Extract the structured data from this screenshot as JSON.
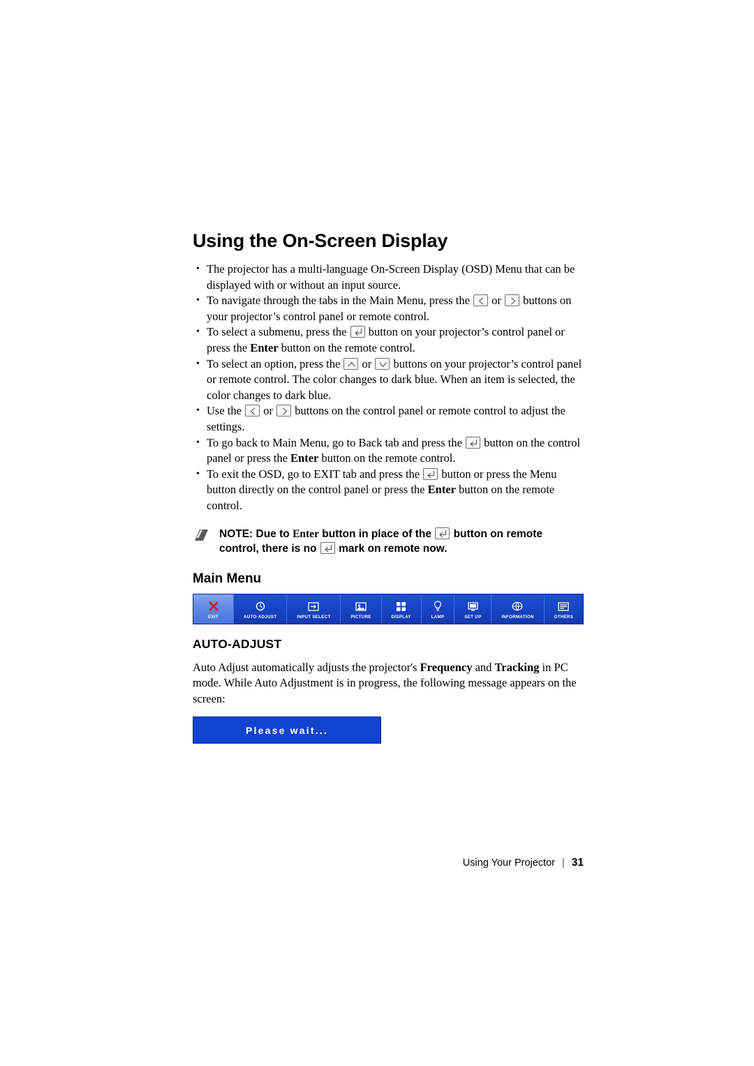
{
  "page": {
    "title": "Using the On-Screen Display",
    "bullets": [
      {
        "segments": [
          {
            "t": "text",
            "v": "The projector has a multi-language On-Screen Display (OSD) Menu that can be displayed with or without an input source."
          }
        ]
      },
      {
        "segments": [
          {
            "t": "text",
            "v": "To navigate through the tabs in the Main Menu, press the "
          },
          {
            "t": "icon",
            "v": "left-arrow-key-icon"
          },
          {
            "t": "text",
            "v": " or "
          },
          {
            "t": "icon",
            "v": "right-arrow-key-icon"
          },
          {
            "t": "text",
            "v": " buttons on your projector’s control panel or remote control."
          }
        ]
      },
      {
        "segments": [
          {
            "t": "text",
            "v": "To select a submenu, press the "
          },
          {
            "t": "icon",
            "v": "enter-key-icon"
          },
          {
            "t": "text",
            "v": " button on your projector’s control panel or press the "
          },
          {
            "t": "bold",
            "v": "Enter"
          },
          {
            "t": "text",
            "v": " button on the remote control."
          }
        ]
      },
      {
        "segments": [
          {
            "t": "text",
            "v": "To select an option, press the "
          },
          {
            "t": "icon",
            "v": "up-arrow-key-icon"
          },
          {
            "t": "text",
            "v": " or "
          },
          {
            "t": "icon",
            "v": "down-arrow-key-icon"
          },
          {
            "t": "text",
            "v": " buttons on your projector’s control panel or remote control. The color changes to dark blue. When an item is selected, the color changes to dark blue."
          }
        ]
      },
      {
        "segments": [
          {
            "t": "text",
            "v": "Use the "
          },
          {
            "t": "icon",
            "v": "left-arrow-key-icon"
          },
          {
            "t": "text",
            "v": " or "
          },
          {
            "t": "icon",
            "v": "right-arrow-key-icon"
          },
          {
            "t": "text",
            "v": " buttons on the control panel or remote control to adjust the settings."
          }
        ]
      },
      {
        "segments": [
          {
            "t": "text",
            "v": "To go back to Main Menu, go to Back tab and press the "
          },
          {
            "t": "icon",
            "v": "enter-key-icon"
          },
          {
            "t": "text",
            "v": " button on the control panel or press the "
          },
          {
            "t": "bold",
            "v": "Enter"
          },
          {
            "t": "text",
            "v": " button on the remote control."
          }
        ]
      },
      {
        "segments": [
          {
            "t": "text",
            "v": "To exit the OSD, go to EXIT tab and press the "
          },
          {
            "t": "icon",
            "v": "enter-key-icon"
          },
          {
            "t": "text",
            "v": " button or press the Menu button directly on the control panel or press the "
          },
          {
            "t": "bold",
            "v": "Enter"
          },
          {
            "t": "text",
            "v": " button on the remote control."
          }
        ]
      }
    ],
    "note": {
      "label": "NOTE:",
      "segments": [
        {
          "t": "text",
          "v": " Due to "
        },
        {
          "t": "serif-bold",
          "v": "Enter"
        },
        {
          "t": "text",
          "v": " button in place of the "
        },
        {
          "t": "icon",
          "v": "enter-key-icon"
        },
        {
          "t": "text",
          "v": " button on remote control, there is no "
        },
        {
          "t": "icon",
          "v": "enter-key-icon"
        },
        {
          "t": "text",
          "v": " mark on remote now."
        }
      ]
    },
    "main_menu_heading": "Main Menu",
    "osd_tabs": [
      {
        "label": "EXIT",
        "icon": "exit-x-icon"
      },
      {
        "label": "AUTO-ADJUST",
        "icon": "auto-adjust-icon"
      },
      {
        "label": "INPUT SELECT",
        "icon": "input-select-icon"
      },
      {
        "label": "PICTURE",
        "icon": "picture-icon"
      },
      {
        "label": "DISPLAY",
        "icon": "display-icon"
      },
      {
        "label": "LAMP",
        "icon": "lamp-icon"
      },
      {
        "label": "SET UP",
        "icon": "setup-icon"
      },
      {
        "label": "INFORMATION",
        "icon": "information-icon"
      },
      {
        "label": "OTHERS",
        "icon": "others-icon"
      }
    ],
    "section_heading": "AUTO-ADJUST",
    "section_paragraph": [
      {
        "t": "text",
        "v": "Auto Adjust automatically adjusts the projector's "
      },
      {
        "t": "bold",
        "v": "Frequency"
      },
      {
        "t": "text",
        "v": " and "
      },
      {
        "t": "bold",
        "v": "Tracking"
      },
      {
        "t": "text",
        "v": " in PC mode. While Auto Adjustment is in progress, the following message appears on the screen:"
      }
    ],
    "wait_message": "Please wait...",
    "footer": {
      "text": "Using Your Projector",
      "separator": "|",
      "page_number": "31"
    },
    "colors": {
      "osd_blue": "#1845c6",
      "osd_exit_blue": "#5d88e6",
      "wait_blue": "#1143cf",
      "exit_red": "#d42020"
    }
  }
}
